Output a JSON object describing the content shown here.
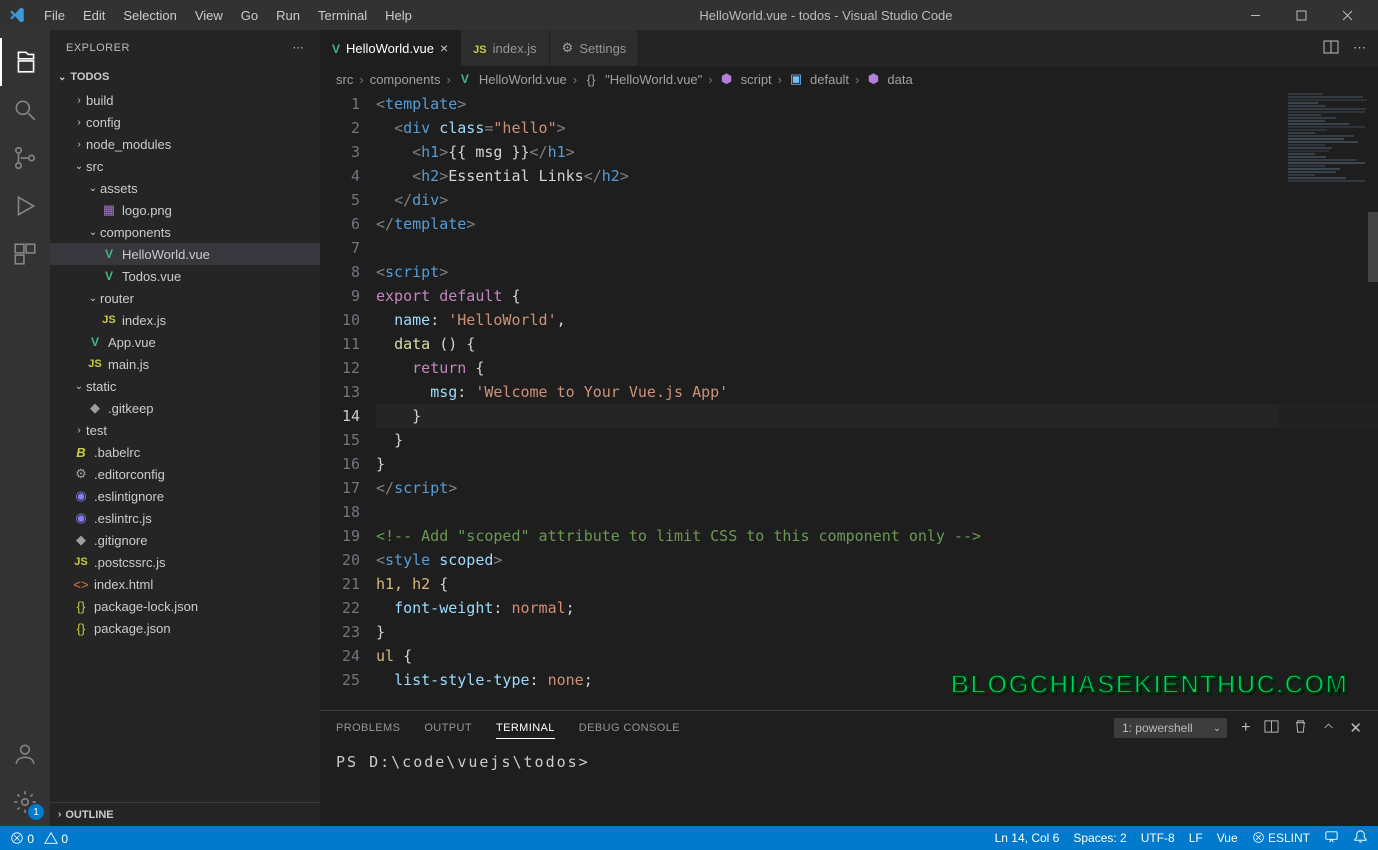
{
  "window": {
    "title": "HelloWorld.vue - todos - Visual Studio Code"
  },
  "menus": [
    "File",
    "Edit",
    "Selection",
    "View",
    "Go",
    "Run",
    "Terminal",
    "Help"
  ],
  "activity": {
    "settings_badge": "1"
  },
  "sidebar": {
    "title": "EXPLORER",
    "root": "TODOS",
    "outline": "OUTLINE",
    "tree": [
      {
        "label": "build",
        "indent": 1,
        "type": "folder",
        "expanded": false
      },
      {
        "label": "config",
        "indent": 1,
        "type": "folder",
        "expanded": false
      },
      {
        "label": "node_modules",
        "indent": 1,
        "type": "folder",
        "expanded": false
      },
      {
        "label": "src",
        "indent": 1,
        "type": "folder",
        "expanded": true
      },
      {
        "label": "assets",
        "indent": 2,
        "type": "folder",
        "expanded": true
      },
      {
        "label": "logo.png",
        "indent": 3,
        "type": "image"
      },
      {
        "label": "components",
        "indent": 2,
        "type": "folder",
        "expanded": true
      },
      {
        "label": "HelloWorld.vue",
        "indent": 3,
        "type": "vue",
        "selected": true
      },
      {
        "label": "Todos.vue",
        "indent": 3,
        "type": "vue"
      },
      {
        "label": "router",
        "indent": 2,
        "type": "folder",
        "expanded": true
      },
      {
        "label": "index.js",
        "indent": 3,
        "type": "js"
      },
      {
        "label": "App.vue",
        "indent": 2,
        "type": "vue"
      },
      {
        "label": "main.js",
        "indent": 2,
        "type": "js"
      },
      {
        "label": "static",
        "indent": 1,
        "type": "folder",
        "expanded": true
      },
      {
        "label": ".gitkeep",
        "indent": 2,
        "type": "file"
      },
      {
        "label": "test",
        "indent": 1,
        "type": "folder",
        "expanded": false
      },
      {
        "label": ".babelrc",
        "indent": 1,
        "type": "babel"
      },
      {
        "label": ".editorconfig",
        "indent": 1,
        "type": "gear"
      },
      {
        "label": ".eslintignore",
        "indent": 1,
        "type": "eslint"
      },
      {
        "label": ".eslintrc.js",
        "indent": 1,
        "type": "eslint"
      },
      {
        "label": ".gitignore",
        "indent": 1,
        "type": "file"
      },
      {
        "label": ".postcssrc.js",
        "indent": 1,
        "type": "js"
      },
      {
        "label": "index.html",
        "indent": 1,
        "type": "html"
      },
      {
        "label": "package-lock.json",
        "indent": 1,
        "type": "json"
      },
      {
        "label": "package.json",
        "indent": 1,
        "type": "json"
      }
    ]
  },
  "tabs": [
    {
      "label": "HelloWorld.vue",
      "icon": "vue",
      "active": true,
      "close": true
    },
    {
      "label": "index.js",
      "icon": "js",
      "active": false,
      "close": false
    },
    {
      "label": "Settings",
      "icon": "gear",
      "active": false,
      "close": false
    }
  ],
  "breadcrumb": [
    {
      "label": "src"
    },
    {
      "label": "components"
    },
    {
      "label": "HelloWorld.vue",
      "icon": "vue"
    },
    {
      "label": "\"HelloWorld.vue\"",
      "icon": "braces"
    },
    {
      "label": "script",
      "icon": "cube"
    },
    {
      "label": "default",
      "icon": "module"
    },
    {
      "label": "data",
      "icon": "cube"
    }
  ],
  "editor": {
    "current_line": 14,
    "lines": [
      {
        "n": 1,
        "html": "<span class='tk-punc'>&lt;</span><span class='tk-tag'>template</span><span class='tk-punc'>&gt;</span>"
      },
      {
        "n": 2,
        "html": "  <span class='tk-punc'>&lt;</span><span class='tk-tag'>div</span> <span class='tk-attr-name'>class</span><span class='tk-punc'>=</span><span class='tk-str'>\"hello\"</span><span class='tk-punc'>&gt;</span>"
      },
      {
        "n": 3,
        "html": "    <span class='tk-punc'>&lt;</span><span class='tk-tag'>h1</span><span class='tk-punc'>&gt;</span><span class='tk-text'>{{ msg }}</span><span class='tk-punc'>&lt;/</span><span class='tk-tag'>h1</span><span class='tk-punc'>&gt;</span>"
      },
      {
        "n": 4,
        "html": "    <span class='tk-punc'>&lt;</span><span class='tk-tag'>h2</span><span class='tk-punc'>&gt;</span><span class='tk-text'>Essential Links</span><span class='tk-punc'>&lt;/</span><span class='tk-tag'>h2</span><span class='tk-punc'>&gt;</span>"
      },
      {
        "n": 5,
        "html": "  <span class='tk-punc'>&lt;/</span><span class='tk-tag'>div</span><span class='tk-punc'>&gt;</span>"
      },
      {
        "n": 6,
        "html": "<span class='tk-punc'>&lt;/</span><span class='tk-tag'>template</span><span class='tk-punc'>&gt;</span>"
      },
      {
        "n": 7,
        "html": ""
      },
      {
        "n": 8,
        "html": "<span class='tk-punc'>&lt;</span><span class='tk-tag'>script</span><span class='tk-punc'>&gt;</span>"
      },
      {
        "n": 9,
        "html": "<span class='tk-kw'>export</span> <span class='tk-kw'>default</span> <span class='tk-text'>{</span>"
      },
      {
        "n": 10,
        "html": "  <span class='tk-prop'>name</span><span class='tk-text'>:</span> <span class='tk-str'>'HelloWorld'</span><span class='tk-text'>,</span>"
      },
      {
        "n": 11,
        "html": "  <span class='tk-fn'>data</span> <span class='tk-text'>() {</span>"
      },
      {
        "n": 12,
        "html": "    <span class='tk-kw'>return</span> <span class='tk-text'>{</span>"
      },
      {
        "n": 13,
        "html": "      <span class='tk-prop'>msg</span><span class='tk-text'>:</span> <span class='tk-str'>'Welcome to Your Vue.js App'</span>"
      },
      {
        "n": 14,
        "html": "    <span class='tk-text'>}</span>"
      },
      {
        "n": 15,
        "html": "  <span class='tk-text'>}</span>"
      },
      {
        "n": 16,
        "html": "<span class='tk-text'>}</span>"
      },
      {
        "n": 17,
        "html": "<span class='tk-punc'>&lt;/</span><span class='tk-tag'>script</span><span class='tk-punc'>&gt;</span>"
      },
      {
        "n": 18,
        "html": ""
      },
      {
        "n": 19,
        "html": "<span class='tk-comment'>&lt;!-- Add \"scoped\" attribute to limit CSS to this component only --&gt;</span>"
      },
      {
        "n": 20,
        "html": "<span class='tk-punc'>&lt;</span><span class='tk-tag'>style</span> <span class='tk-attr-name'>scoped</span><span class='tk-punc'>&gt;</span>"
      },
      {
        "n": 21,
        "html": "<span class='tk-sel'>h1, h2</span> <span class='tk-text'>{</span>"
      },
      {
        "n": 22,
        "html": "  <span class='tk-prop'>font-weight</span><span class='tk-text'>:</span> <span class='tk-str'>normal</span><span class='tk-text'>;</span>"
      },
      {
        "n": 23,
        "html": "<span class='tk-text'>}</span>"
      },
      {
        "n": 24,
        "html": "<span class='tk-sel'>ul</span> <span class='tk-text'>{</span>"
      },
      {
        "n": 25,
        "html": "  <span class='tk-prop'>list-style-type</span><span class='tk-text'>:</span> <span class='tk-str'>none</span><span class='tk-text'>;</span>"
      }
    ]
  },
  "panel": {
    "tabs": [
      "PROBLEMS",
      "OUTPUT",
      "TERMINAL",
      "DEBUG CONSOLE"
    ],
    "active": "TERMINAL",
    "shell_label": "1: powershell",
    "prompt": "PS D:\\code\\vuejs\\todos>"
  },
  "status": {
    "errors": "0",
    "warnings": "0",
    "cursor": "Ln 14, Col 6",
    "spaces": "Spaces: 2",
    "encoding": "UTF-8",
    "eol": "LF",
    "language": "Vue",
    "eslint": "ESLINT"
  },
  "watermark": "BLOGCHIASEKIENTHUC.COM"
}
